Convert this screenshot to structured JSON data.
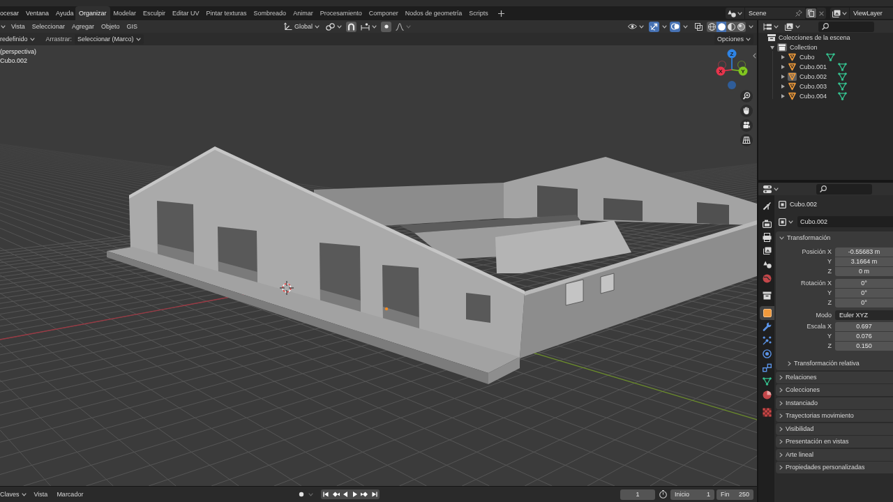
{
  "topbar": {
    "menus": [
      {
        "label": "ocesar"
      },
      {
        "label": "Ventana"
      },
      {
        "label": "Ayuda"
      }
    ],
    "workspaces": [
      {
        "label": "Organizar",
        "selected": true
      },
      {
        "label": "Modelar",
        "selected": false
      },
      {
        "label": "Esculpir",
        "selected": false
      },
      {
        "label": "Editar UV",
        "selected": false
      },
      {
        "label": "Pintar texturas",
        "selected": false
      },
      {
        "label": "Sombreado",
        "selected": false
      },
      {
        "label": "Animar",
        "selected": false
      },
      {
        "label": "Procesamiento",
        "selected": false
      },
      {
        "label": "Componer",
        "selected": false
      },
      {
        "label": "Nodos de geometría",
        "selected": false
      },
      {
        "label": "Scripts",
        "selected": false
      }
    ],
    "scene": "Scene",
    "view_layer": "ViewLayer"
  },
  "viewport_header": {
    "menus": [
      {
        "label": "Vista"
      },
      {
        "label": "Seleccionar"
      },
      {
        "label": "Agregar"
      },
      {
        "label": "Objeto"
      },
      {
        "label": "GIS"
      }
    ],
    "orientation": "Global",
    "snapping": {
      "on": true
    },
    "proportional_editing": {
      "on": true
    },
    "gizmos": {
      "on": true
    },
    "overlays": {
      "on": true
    },
    "xray": {
      "on": false
    },
    "shading": [
      {
        "kind": "wireframe",
        "selected": false
      },
      {
        "kind": "solid",
        "selected": true
      },
      {
        "kind": "material",
        "selected": false
      },
      {
        "kind": "rendered",
        "selected": false
      }
    ]
  },
  "tool_header": {
    "preset": "redefinido",
    "drag_label": "Arrastrar:",
    "drag_value": "Seleccionar (Marco)",
    "options": "Opciones"
  },
  "viewport": {
    "view_name": "(perspectiva)",
    "object_info": "Cubo.002",
    "gizmo_axes": [
      {
        "label": "Z",
        "color": "#2e84e6"
      },
      {
        "label": "X",
        "color": "#e8344c"
      },
      {
        "label": "Y",
        "color": "#80c520"
      }
    ]
  },
  "timeline": {
    "keying": "Claves",
    "menus": [
      {
        "label": "Vista"
      },
      {
        "label": "Marcador"
      }
    ],
    "auto_keying": {
      "on": false
    },
    "current_frame": "1",
    "start": {
      "label": "Inicio",
      "value": "1"
    },
    "end": {
      "label": "Fin",
      "value": "250"
    }
  },
  "outliner": {
    "tree": [
      {
        "label": "Colecciones de la escena",
        "kind": "scene_collection",
        "children": [
          {
            "label": "Collection",
            "kind": "collection",
            "expanded": true,
            "active": true,
            "children": [
              {
                "label": "Cubo",
                "kind": "mesh_object",
                "expanded": false,
                "active": false
              },
              {
                "label": "Cubo.001",
                "kind": "mesh_object",
                "expanded": false,
                "active": false
              },
              {
                "label": "Cubo.002",
                "kind": "mesh_object",
                "expanded": false,
                "active": true
              },
              {
                "label": "Cubo.003",
                "kind": "mesh_object",
                "expanded": false,
                "active": false
              },
              {
                "label": "Cubo.004",
                "kind": "mesh_object",
                "expanded": false,
                "active": false
              }
            ]
          }
        ]
      }
    ]
  },
  "properties": {
    "tab_groups": [
      {
        "tabs": [
          {
            "kind": "tool",
            "selected": false
          }
        ]
      },
      {
        "tabs": [
          {
            "kind": "render",
            "selected": false
          },
          {
            "kind": "output",
            "selected": false
          },
          {
            "kind": "view_layer",
            "selected": false
          },
          {
            "kind": "scene",
            "selected": false
          },
          {
            "kind": "world",
            "selected": false
          }
        ]
      },
      {
        "tabs": [
          {
            "kind": "collection",
            "selected": false
          }
        ]
      },
      {
        "tabs": [
          {
            "kind": "object",
            "selected": true
          },
          {
            "kind": "modifiers",
            "selected": false
          },
          {
            "kind": "particles",
            "selected": false
          },
          {
            "kind": "physics",
            "selected": false
          },
          {
            "kind": "constraints",
            "selected": false
          },
          {
            "kind": "data",
            "selected": false
          },
          {
            "kind": "material",
            "selected": false
          }
        ]
      },
      {
        "tabs": [
          {
            "kind": "texture",
            "selected": false
          }
        ]
      }
    ],
    "object_name": "Cubo.002",
    "datablock": "Cubo.002",
    "panels": [
      {
        "title": "Transformación",
        "expanded": true,
        "groups": [
          {
            "rows": [
              {
                "label": "Posición X",
                "value": "-0.55683 m",
                "kind": "number"
              },
              {
                "label": "Y",
                "value": "3.1664 m",
                "kind": "number"
              },
              {
                "label": "Z",
                "value": "0 m",
                "kind": "number"
              }
            ]
          },
          {
            "rows": [
              {
                "label": "Rotación X",
                "value": "0°",
                "kind": "number"
              },
              {
                "label": "Y",
                "value": "0°",
                "kind": "number"
              },
              {
                "label": "Z",
                "value": "0°",
                "kind": "number"
              }
            ]
          },
          {
            "rows": [
              {
                "label": "Modo",
                "value": "Euler XYZ",
                "kind": "dropdown"
              }
            ]
          },
          {
            "rows": [
              {
                "label": "Escala X",
                "value": "0.697",
                "kind": "number"
              },
              {
                "label": "Y",
                "value": "0.076",
                "kind": "number"
              },
              {
                "label": "Z",
                "value": "0.150",
                "kind": "number"
              }
            ]
          }
        ],
        "subpanels": [
          {
            "title": "Transformación relativa",
            "expanded": false
          }
        ]
      },
      {
        "title": "Relaciones",
        "expanded": false
      },
      {
        "title": "Colecciones",
        "expanded": false
      },
      {
        "title": "Instanciado",
        "expanded": false
      },
      {
        "title": "Trayectorias movimiento",
        "expanded": false
      },
      {
        "title": "Visibilidad",
        "expanded": false
      },
      {
        "title": "Presentación en vistas",
        "expanded": false
      },
      {
        "title": "Arte lineal",
        "expanded": false
      },
      {
        "title": "Propiedades personalizadas",
        "expanded": false
      }
    ]
  }
}
